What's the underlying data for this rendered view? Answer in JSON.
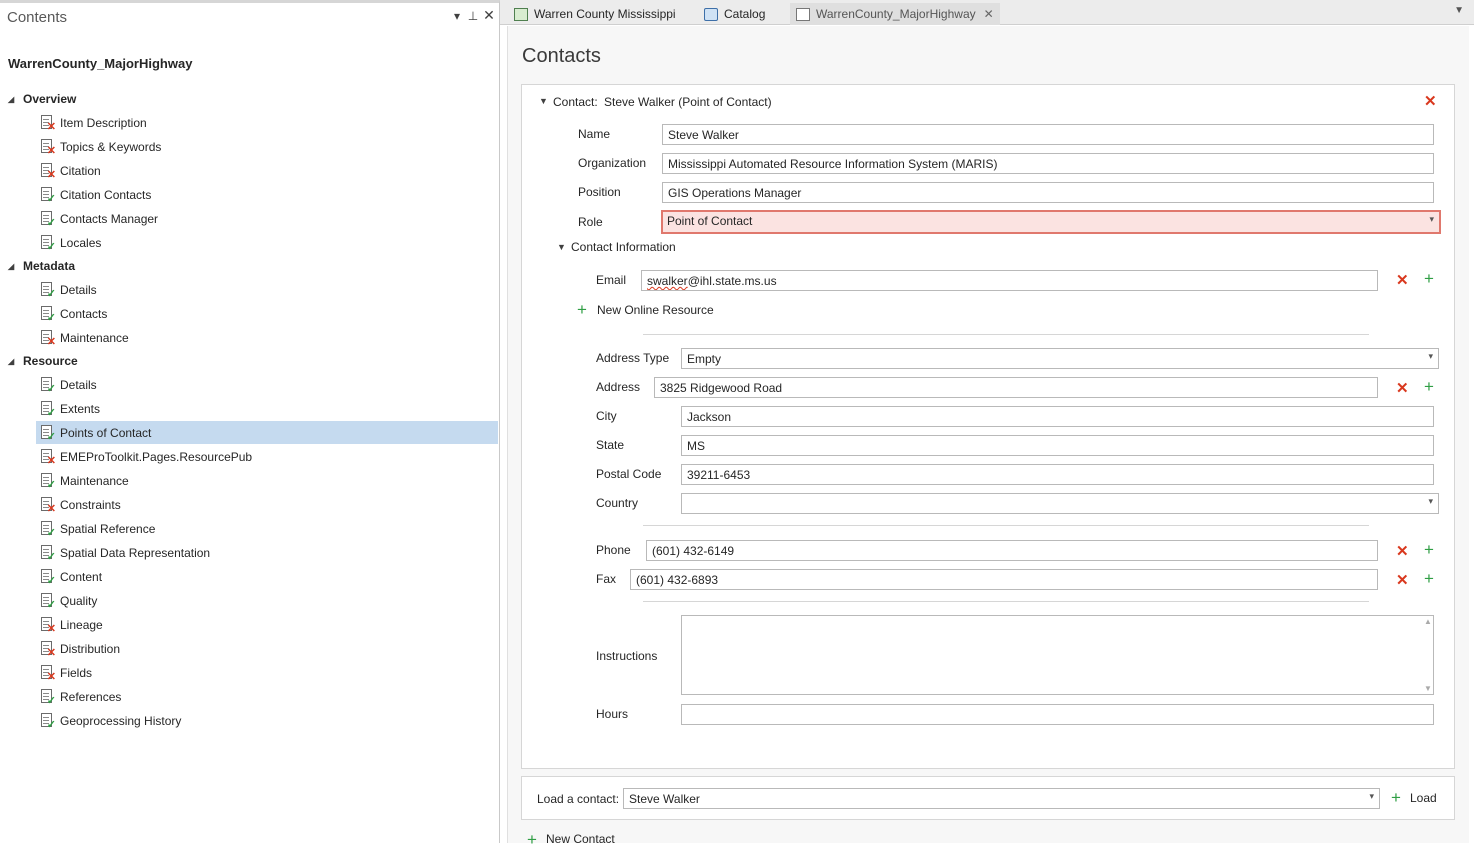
{
  "contents_pane": {
    "title": "Contents",
    "doc_title": "WarrenCounty_MajorHighway",
    "sections": [
      {
        "label": "Overview",
        "items": [
          {
            "label": "Item Description",
            "status": "error"
          },
          {
            "label": "Topics & Keywords",
            "status": "error"
          },
          {
            "label": "Citation",
            "status": "error"
          },
          {
            "label": "Citation Contacts",
            "status": "ok"
          },
          {
            "label": "Contacts Manager",
            "status": "ok"
          },
          {
            "label": "Locales",
            "status": "ok"
          }
        ]
      },
      {
        "label": "Metadata",
        "items": [
          {
            "label": "Details",
            "status": "ok"
          },
          {
            "label": "Contacts",
            "status": "ok"
          },
          {
            "label": "Maintenance",
            "status": "error"
          }
        ]
      },
      {
        "label": "Resource",
        "items": [
          {
            "label": "Details",
            "status": "ok"
          },
          {
            "label": "Extents",
            "status": "ok"
          },
          {
            "label": "Points of Contact",
            "status": "ok",
            "selected": true
          },
          {
            "label": "EMEProToolkit.Pages.ResourcePub",
            "status": "error"
          },
          {
            "label": "Maintenance",
            "status": "ok"
          },
          {
            "label": "Constraints",
            "status": "error"
          },
          {
            "label": "Spatial Reference",
            "status": "ok"
          },
          {
            "label": "Spatial Data Representation",
            "status": "ok"
          },
          {
            "label": "Content",
            "status": "ok"
          },
          {
            "label": "Quality",
            "status": "ok"
          },
          {
            "label": "Lineage",
            "status": "error"
          },
          {
            "label": "Distribution",
            "status": "error"
          },
          {
            "label": "Fields",
            "status": "error"
          },
          {
            "label": "References",
            "status": "ok"
          },
          {
            "label": "Geoprocessing History",
            "status": "ok"
          }
        ]
      }
    ]
  },
  "tabs": [
    {
      "label": "Warren County Mississippi",
      "icon": "map-icon"
    },
    {
      "label": "Catalog",
      "icon": "catalog-icon"
    },
    {
      "label": "WarrenCounty_MajorHighway",
      "icon": "metadata-icon",
      "active": true,
      "closable": true
    }
  ],
  "main": {
    "title": "Contacts",
    "contact": {
      "header_prefix": "Contact:",
      "header_name": "Steve Walker (Point of Contact)",
      "name_label": "Name",
      "name": "Steve Walker",
      "org_label": "Organization",
      "organization": "Mississippi Automated Resource Information System (MARIS)",
      "position_label": "Position",
      "position": "GIS Operations Manager",
      "role_label": "Role",
      "role": "Point of Contact",
      "contact_info_label": "Contact Information",
      "email_label": "Email",
      "email_user": "swalker",
      "email_domain": "@ihl.state.ms.us",
      "new_online_resource": "New Online Resource",
      "address_type_label": "Address Type",
      "address_type": "Empty",
      "address_label": "Address",
      "address": "3825 Ridgewood Road",
      "city_label": "City",
      "city": "Jackson",
      "state_label": "State",
      "state": "MS",
      "postal_label": "Postal Code",
      "postal": "39211-6453",
      "country_label": "Country",
      "country": "",
      "phone_label": "Phone",
      "phone": "(601) 432-6149",
      "fax_label": "Fax",
      "fax": "(601) 432-6893",
      "instructions_label": "Instructions",
      "instructions": "",
      "hours_label": "Hours",
      "hours": ""
    },
    "load": {
      "label": "Load a contact:",
      "value": "Steve Walker",
      "button": "Load"
    },
    "new_contact": "New Contact"
  }
}
